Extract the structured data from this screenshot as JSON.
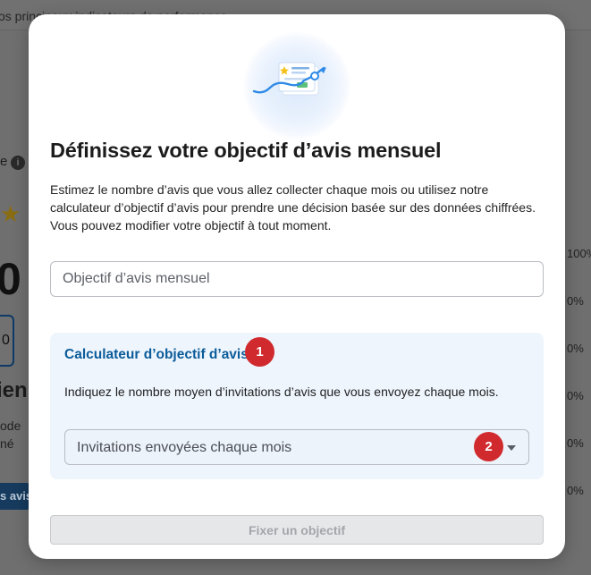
{
  "background": {
    "intro_text": "os principaux indicateurs de performance",
    "label_fragment": "e",
    "info_symbol": "i",
    "star_symbol": "★",
    "big_number": "0",
    "box_digit": "0",
    "heading_fragment": "ien",
    "line_fragment_1": "ode",
    "line_fragment_2": "né",
    "button_fragment": "s avis",
    "percentages": [
      "100%",
      "0%",
      "0%",
      "0%",
      "0%",
      "0%"
    ]
  },
  "modal": {
    "title": "Définissez votre objectif d’avis mensuel",
    "description": "Estimez le nombre d’avis que vous allez collecter chaque mois ou utilisez notre calculateur d’objectif d’avis pour prendre une décision basée sur des données chiffrées. Vous pouvez modifier votre objectif à tout moment.",
    "goal_input": {
      "placeholder": "Objectif d’avis mensuel",
      "value": ""
    },
    "calculator": {
      "title": "Calculateur d’objectif d’avis",
      "marker_1": "1",
      "description": "Indiquez le nombre moyen d’invitations d’avis que vous envoyez chaque mois.",
      "select_placeholder": "Invitations envoyées chaque mois",
      "marker_2": "2"
    },
    "submit_label": "Fixer un objectif"
  },
  "colors": {
    "accent_blue": "#0b5c99",
    "marker_red": "#d12a2e",
    "panel_bg": "#eef5fd",
    "disabled_button": "#e6e7e9"
  },
  "icons": {
    "illustration": "chart-document-illustration",
    "select_caret": "chevron-down-icon"
  }
}
